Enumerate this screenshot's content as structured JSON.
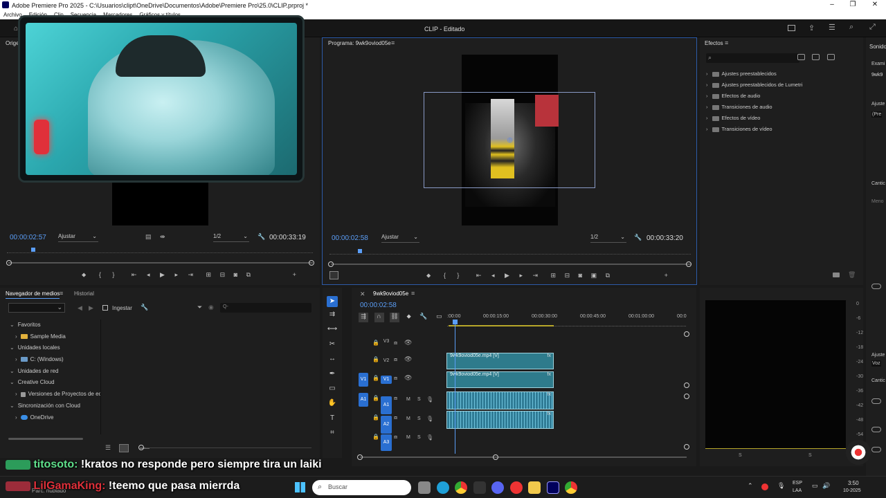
{
  "window": {
    "title": "Adobe Premiere Pro 2025 - C:\\Usuarios\\clipt\\OneDrive\\Documentos\\Adobe\\Premiere Pro\\25.0\\CLIP.prproj *",
    "header_title": "CLIP - Editado",
    "controls": [
      "–",
      "❐",
      "✕"
    ]
  },
  "menu": [
    "Archivo",
    "Edición",
    "Clip",
    "Secuencia",
    "Marcadores",
    "Gráficos y títulos"
  ],
  "source_monitor": {
    "tab": "Orige",
    "timecode_in": "00:00:02:57",
    "fit": "Ajustar",
    "resolution": "1/2",
    "timecode_out": "00:00:33:19"
  },
  "program_monitor": {
    "tab": "Programa: 9wk9oviod05e",
    "timecode_in": "00:00:02:58",
    "fit": "Ajustar",
    "resolution": "1/2",
    "timecode_out": "00:00:33:20"
  },
  "effects": {
    "title": "Efectos",
    "items": [
      "Ajustes preestablecidos",
      "Ajustes preestablecidos de Lumetri",
      "Efectos de audio",
      "Transiciones de audio",
      "Efectos de vídeo",
      "Transiciones de vídeo"
    ]
  },
  "sound_panel": {
    "title": "Sonido",
    "labels": [
      "Exami",
      "9wk9",
      "Ajuste",
      "(Pre",
      "Cantic",
      "Meno",
      "Ajuste",
      "Voz",
      "Cantic"
    ]
  },
  "media_browser": {
    "tab_active": "Navegador de medios",
    "tab_other": "Historial",
    "ingest": "Ingestar",
    "search_placeholder": "Q-",
    "tree": [
      {
        "label": "Favoritos",
        "level": 0,
        "type": "section"
      },
      {
        "label": "Sample Media",
        "level": 1,
        "type": "folder"
      },
      {
        "label": "Unidades locales",
        "level": 0,
        "type": "section"
      },
      {
        "label": "C: (Windows)",
        "level": 1,
        "type": "drive"
      },
      {
        "label": "Unidades de red",
        "level": 0,
        "type": "section"
      },
      {
        "label": "Creative Cloud",
        "level": 0,
        "type": "section"
      },
      {
        "label": "Versiones de Proyectos de ec",
        "level": 1,
        "type": "doc"
      },
      {
        "label": "Sincronización con Cloud",
        "level": 0,
        "type": "section"
      },
      {
        "label": "OneDrive",
        "level": 1,
        "type": "cloud"
      }
    ]
  },
  "timeline": {
    "sequence": "9wk9oviod05e",
    "timecode": "00:00:02:58",
    "ruler": [
      ":00:00",
      "00:00:15:00",
      "00:00:30:00",
      "00:00:45:00",
      "00:01:00:00",
      "00:0"
    ],
    "video_tracks": [
      "V3",
      "V2",
      "V1"
    ],
    "audio_tracks": [
      "A1",
      "A2",
      "A3"
    ],
    "source_targets": [
      "V1",
      "A1"
    ],
    "track_buttons": [
      "M",
      "S"
    ],
    "clip_v2": "9wk9oviod05e.mp4 [V]",
    "clip_v1": "9wk9oviod05e.mp4 [V]",
    "fx": "fx"
  },
  "meters": {
    "scale": [
      "0",
      "-6",
      "-12",
      "-18",
      "-24",
      "-30",
      "-36",
      "-42",
      "-48",
      "-54"
    ],
    "solo_labels": [
      "S",
      "S"
    ]
  },
  "chat": [
    {
      "user": "titosoto:",
      "message": "!kratos no responde pero siempre tira un laiki",
      "user_color": "#5fe08b"
    },
    {
      "user": "LilGamaKing:",
      "message": "!teemo que pasa mierrda",
      "user_color": "#e0303a"
    }
  ],
  "chat_overlap_text": "Parc. nublado",
  "taskbar": {
    "search": "Buscar",
    "lang": "ESP",
    "lang2": "LAA",
    "time": "3:50",
    "date": "10-2025"
  },
  "colors": {
    "accent": "#2a6fd1",
    "timecode_blue": "#5b9ef7",
    "clip_teal": "#2e7b8c",
    "webcam_frame": "#1a2a2a"
  }
}
